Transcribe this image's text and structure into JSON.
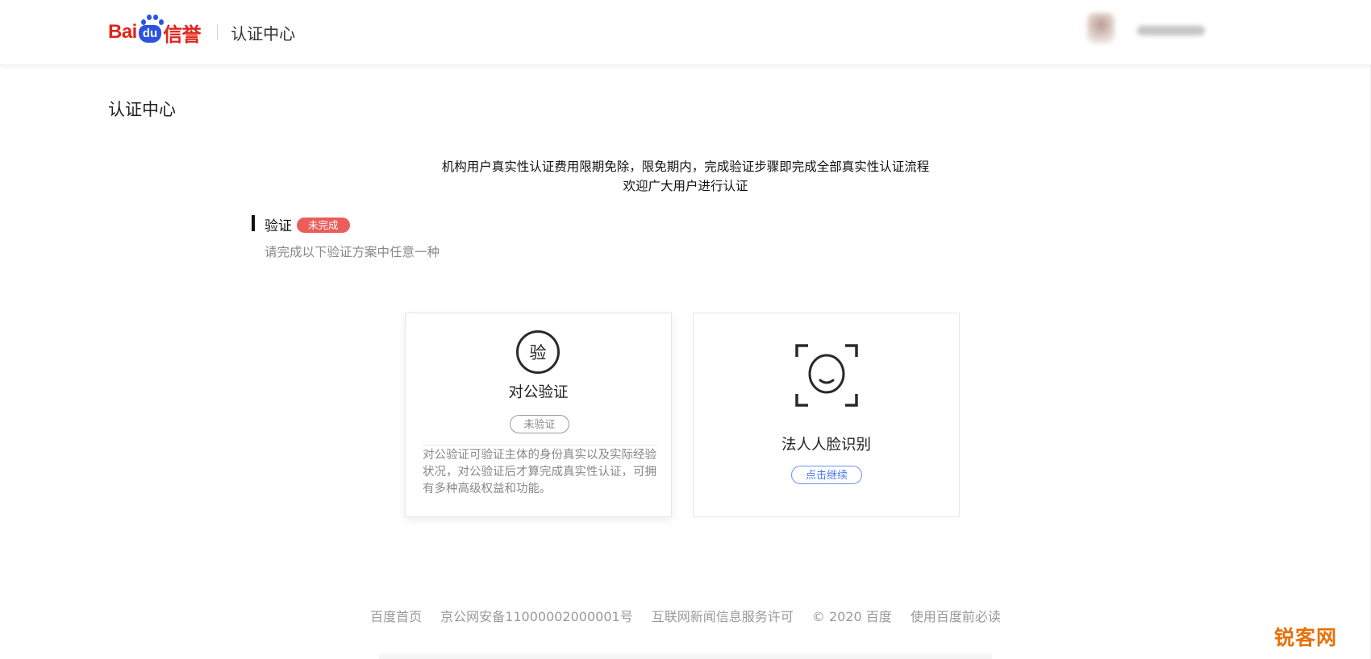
{
  "header": {
    "logo": {
      "part1": "Bai",
      "part2": "du",
      "part3": "信誉"
    },
    "title": "认证中心"
  },
  "page": {
    "title": "认证中心",
    "notice_line1": "机构用户真实性认证费用限期免除，限免期内，完成验证步骤即完成全部真实性认证流程",
    "notice_line2": "欢迎广大用户进行认证"
  },
  "section": {
    "title": "验证",
    "badge": "未完成",
    "subtitle": "请完成以下验证方案中任意一种"
  },
  "cards": [
    {
      "icon": "seal-icon",
      "icon_glyph": "验",
      "title": "对公验证",
      "status": "未验证",
      "description": "对公验证可验证主体的身份真实以及实际经验状况，对公验证后才算完成真实性认证，可拥有多种高级权益和功能。"
    },
    {
      "icon": "face-scan-icon",
      "title": "法人人脸识别",
      "action": "点击继续"
    }
  ],
  "footer": {
    "links": [
      "百度首页",
      "京公网安备11000002000001号",
      "互联网新闻信息服务许可",
      "© 2020 百度",
      "使用百度前必读"
    ]
  },
  "watermark": "锐客网",
  "colors": {
    "brand_red": "#e1251b",
    "brand_blue": "#2b53e0",
    "badge_red": "#ea5d5a",
    "link_blue": "#4b7be5",
    "watermark_orange": "#e8710a"
  }
}
